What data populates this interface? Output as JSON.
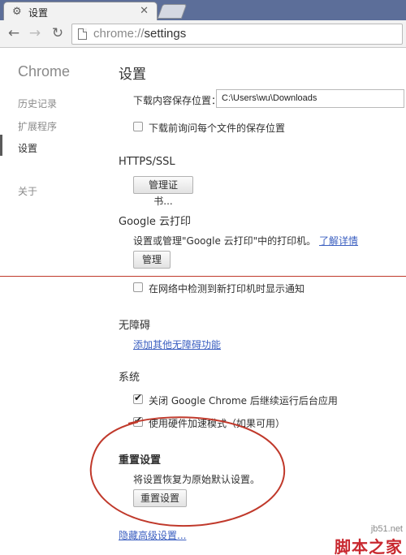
{
  "browser": {
    "tab_title": "设置",
    "url_scheme": "chrome://",
    "url_path": "settings"
  },
  "sidebar": {
    "title": "Chrome",
    "items": [
      {
        "label": "历史记录"
      },
      {
        "label": "扩展程序"
      },
      {
        "label": "设置"
      },
      {
        "label": "关于"
      }
    ]
  },
  "main": {
    "title": "设置",
    "downloads": {
      "location_label": "下载内容保存位置：",
      "location_value": "C:\\Users\\wu\\Downloads",
      "ask_label": "下载前询问每个文件的保存位置"
    },
    "https": {
      "heading": "HTTPS/SSL",
      "button": "管理证书..."
    },
    "cloud_print": {
      "heading": "Google 云打印",
      "desc": "设置或管理\"Google 云打印\"中的打印机。",
      "learn_more": "了解详情",
      "button": "管理",
      "notify_label": "在网络中检测到新打印机时显示通知"
    },
    "accessibility": {
      "heading": "无障碍",
      "link": "添加其他无障碍功能"
    },
    "system": {
      "heading": "系统",
      "background_label": "关闭 Google Chrome 后继续运行后台应用",
      "hwaccel_label": "使用硬件加速模式（如果可用）"
    },
    "reset": {
      "heading": "重置设置",
      "desc": "将设置恢复为原始默认设置。",
      "button": "重置设置"
    },
    "hide_advanced": "隐藏高级设置..."
  },
  "watermark": {
    "url": "jb51.net",
    "logo": "脚本之家"
  },
  "colors": {
    "annotation_red": "#c0392b",
    "link_blue": "#3b5fc0"
  }
}
